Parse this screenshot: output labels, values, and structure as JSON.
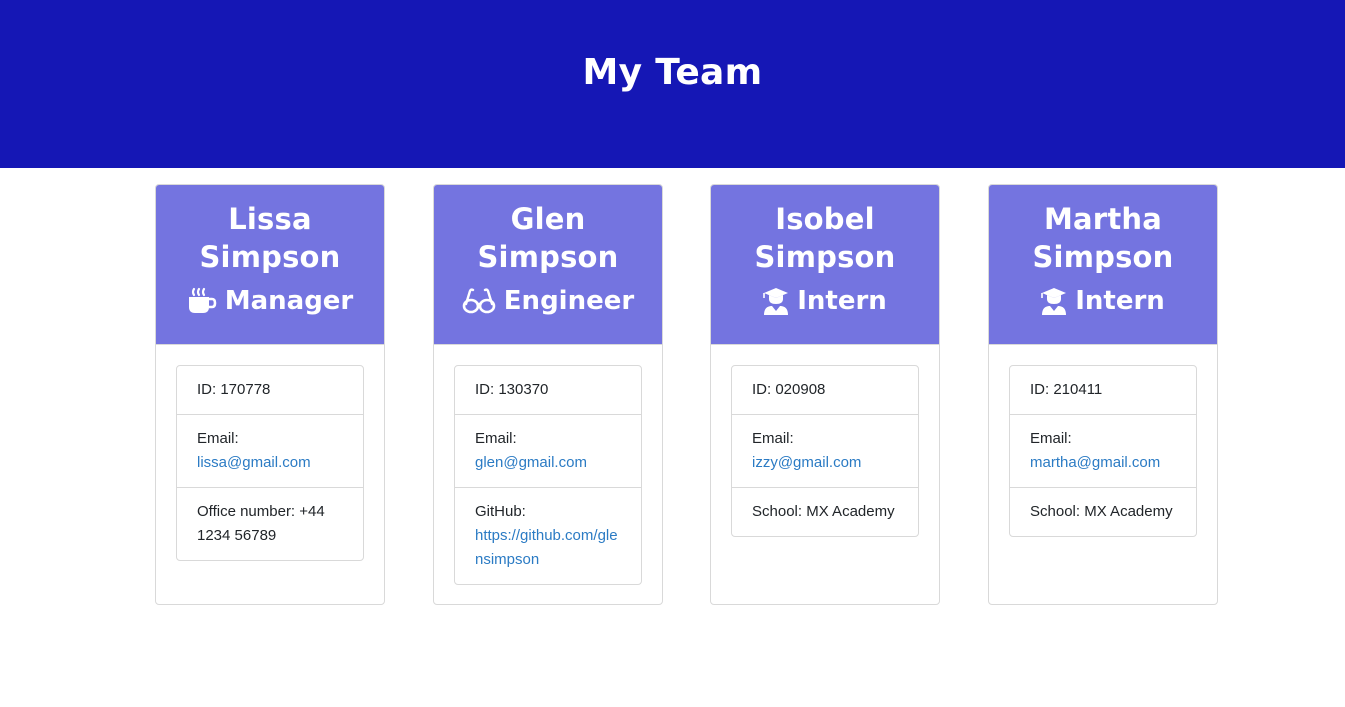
{
  "page": {
    "title": "My Team"
  },
  "colors": {
    "header": "#1517b5",
    "card_head": "#7474e0",
    "link": "#2b7bc4"
  },
  "team": [
    {
      "first": "Lissa",
      "last": "Simpson",
      "role": "Manager",
      "icon": "coffee-icon",
      "id_text": "ID: 170778",
      "email_label": "Email:",
      "email": "lissa@gmail.com",
      "extra_label": "Office number:",
      "extra_value": "+44 1234 56789"
    },
    {
      "first": "Glen",
      "last": "Simpson",
      "role": "Engineer",
      "icon": "glasses-icon",
      "id_text": "ID: 130370",
      "email_label": "Email:",
      "email": "glen@gmail.com",
      "extra_label": "GitHub:",
      "extra_value": "https://github.com/glensimpson"
    },
    {
      "first": "Isobel",
      "last": "Simpson",
      "role": "Intern",
      "icon": "graduate-icon",
      "id_text": "ID: 020908",
      "email_label": "Email:",
      "email": "izzy@gmail.com",
      "extra_label": "School:",
      "extra_value": "MX Academy"
    },
    {
      "first": "Martha",
      "last": "Simpson",
      "role": "Intern",
      "icon": "graduate-icon",
      "id_text": "ID: 210411",
      "email_label": "Email:",
      "email": "martha@gmail.com",
      "extra_label": "School:",
      "extra_value": "MX Academy"
    }
  ]
}
